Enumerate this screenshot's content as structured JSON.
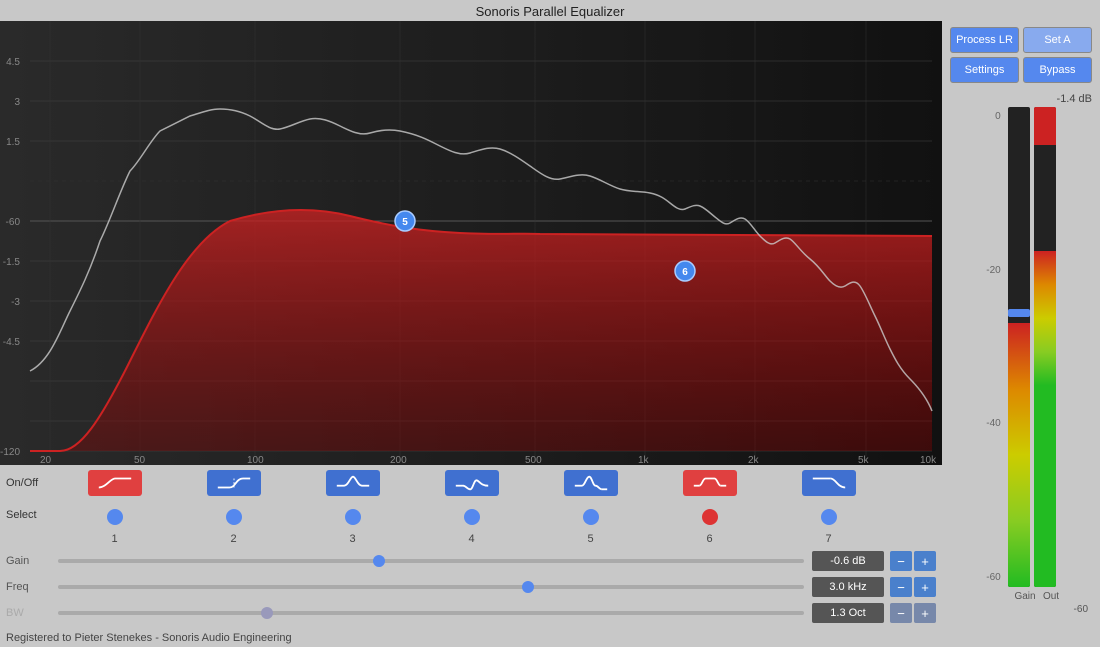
{
  "title": "Sonoris Parallel Equalizer",
  "buttons": {
    "process_lr": "Process LR",
    "set_a": "Set A",
    "settings": "Settings",
    "bypass": "Bypass"
  },
  "eq": {
    "x_labels": [
      "20",
      "50",
      "100",
      "200",
      "500",
      "1k",
      "2k",
      "5k",
      "10k"
    ],
    "y_labels": [
      "4.5",
      "3",
      "1.5",
      "-60",
      "-1.5",
      "-3",
      "-4.5",
      "-120"
    ],
    "db_marks": [
      "4.5",
      "3",
      "1.5",
      "",
      "-1.5",
      "-3",
      "-4.5"
    ]
  },
  "bands": [
    {
      "id": 1,
      "type": "high_pass",
      "color": "red",
      "select": "blue"
    },
    {
      "id": 2,
      "type": "low_shelf",
      "color": "blue",
      "select": "blue"
    },
    {
      "id": 3,
      "type": "peak",
      "color": "blue",
      "select": "blue"
    },
    {
      "id": 4,
      "type": "peak2",
      "color": "blue",
      "select": "blue"
    },
    {
      "id": 5,
      "type": "peak3",
      "color": "blue",
      "select": "blue"
    },
    {
      "id": 6,
      "type": "band_pass",
      "color": "red",
      "select": "red"
    },
    {
      "id": 7,
      "type": "low_pass",
      "color": "blue",
      "select": "blue"
    }
  ],
  "params": {
    "gain": {
      "label": "Gain",
      "value": "-0.6 dB",
      "thumb_pct": 43
    },
    "freq": {
      "label": "Freq",
      "value": "3.0 kHz",
      "thumb_pct": 63
    },
    "bw": {
      "label": "BW",
      "value": "1.3 Oct",
      "thumb_pct": 28,
      "disabled": true
    }
  },
  "footer": "Registered to Pieter Stenekes - Sonoris Audio Engineering",
  "vu": {
    "db_top": "-1.4 dB",
    "scale": [
      "0",
      "-20",
      "-40",
      "-60"
    ],
    "gain_label": "Gain",
    "out_label": "Out"
  }
}
